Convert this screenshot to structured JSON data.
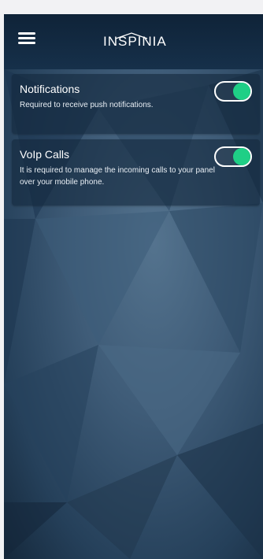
{
  "header": {
    "menu_icon": "hamburger-menu-icon",
    "logo_text": "INSPINIA"
  },
  "settings": [
    {
      "title": "Notifications",
      "description": "Required to receive push notifications.",
      "enabled": true
    },
    {
      "title": "VoIp Calls",
      "description": "It is required to manage the incoming calls to your panel over your mobile phone.",
      "enabled": true
    }
  ],
  "colors": {
    "toggle_on": "#1fcf86",
    "header_bg": "#0f2338",
    "card_bg": "#14283e"
  }
}
